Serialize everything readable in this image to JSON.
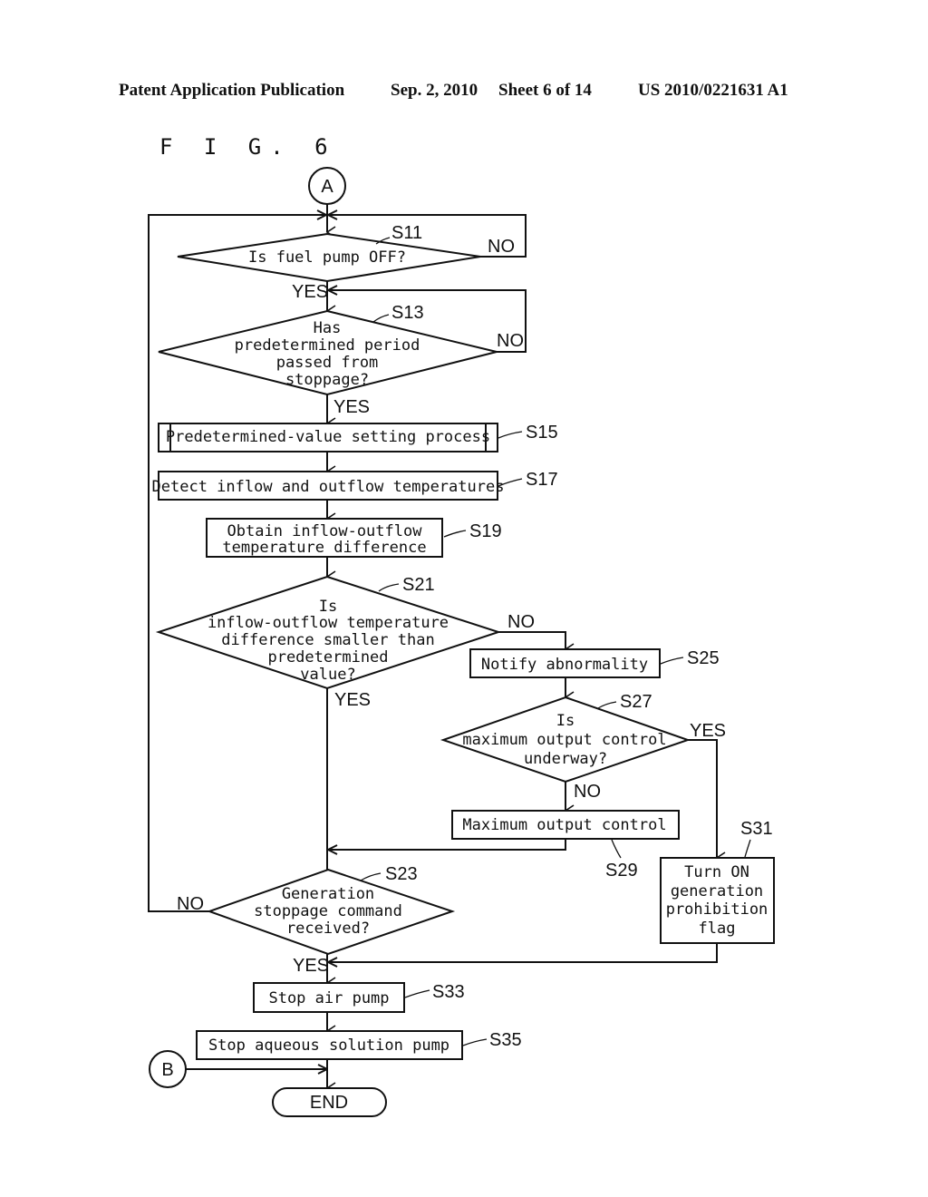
{
  "header": {
    "publication": "Patent Application Publication",
    "date": "Sep. 2, 2010",
    "sheet": "Sheet 6 of 14",
    "number": "US 2010/0221631 A1"
  },
  "figure_label": "F I G. 6",
  "connectors": {
    "start": "A",
    "join": "B"
  },
  "terminal": {
    "end": "END"
  },
  "branch_labels": {
    "yes": "YES",
    "no": "NO"
  },
  "steps": {
    "S11": {
      "id": "S11",
      "type": "decision",
      "lines": [
        "Is fuel pump OFF?"
      ]
    },
    "S13": {
      "id": "S13",
      "type": "decision",
      "lines": [
        "Has",
        "predetermined period",
        "passed from",
        "stoppage?"
      ]
    },
    "S15": {
      "id": "S15",
      "type": "subprocess",
      "lines": [
        "Predetermined-value setting process"
      ]
    },
    "S17": {
      "id": "S17",
      "type": "process",
      "lines": [
        "Detect inflow and outflow temperatures"
      ]
    },
    "S19": {
      "id": "S19",
      "type": "process",
      "lines": [
        "Obtain inflow-outflow",
        "temperature difference"
      ]
    },
    "S21": {
      "id": "S21",
      "type": "decision",
      "lines": [
        "Is",
        "inflow-outflow temperature",
        "difference smaller than",
        "predetermined",
        "value?"
      ]
    },
    "S23": {
      "id": "S23",
      "type": "decision",
      "lines": [
        "Generation",
        "stoppage command",
        "received?"
      ]
    },
    "S25": {
      "id": "S25",
      "type": "process",
      "lines": [
        "Notify abnormality"
      ]
    },
    "S27": {
      "id": "S27",
      "type": "decision",
      "lines": [
        "Is",
        "maximum output control",
        "underway?"
      ]
    },
    "S29": {
      "id": "S29",
      "type": "process",
      "lines": [
        "Maximum output control"
      ]
    },
    "S31": {
      "id": "S31",
      "type": "process",
      "lines": [
        "Turn ON",
        "generation",
        "prohibition",
        "flag"
      ]
    },
    "S33": {
      "id": "S33",
      "type": "process",
      "lines": [
        "Stop air pump"
      ]
    },
    "S35": {
      "id": "S35",
      "type": "process",
      "lines": [
        "Stop aqueous solution pump"
      ]
    }
  }
}
